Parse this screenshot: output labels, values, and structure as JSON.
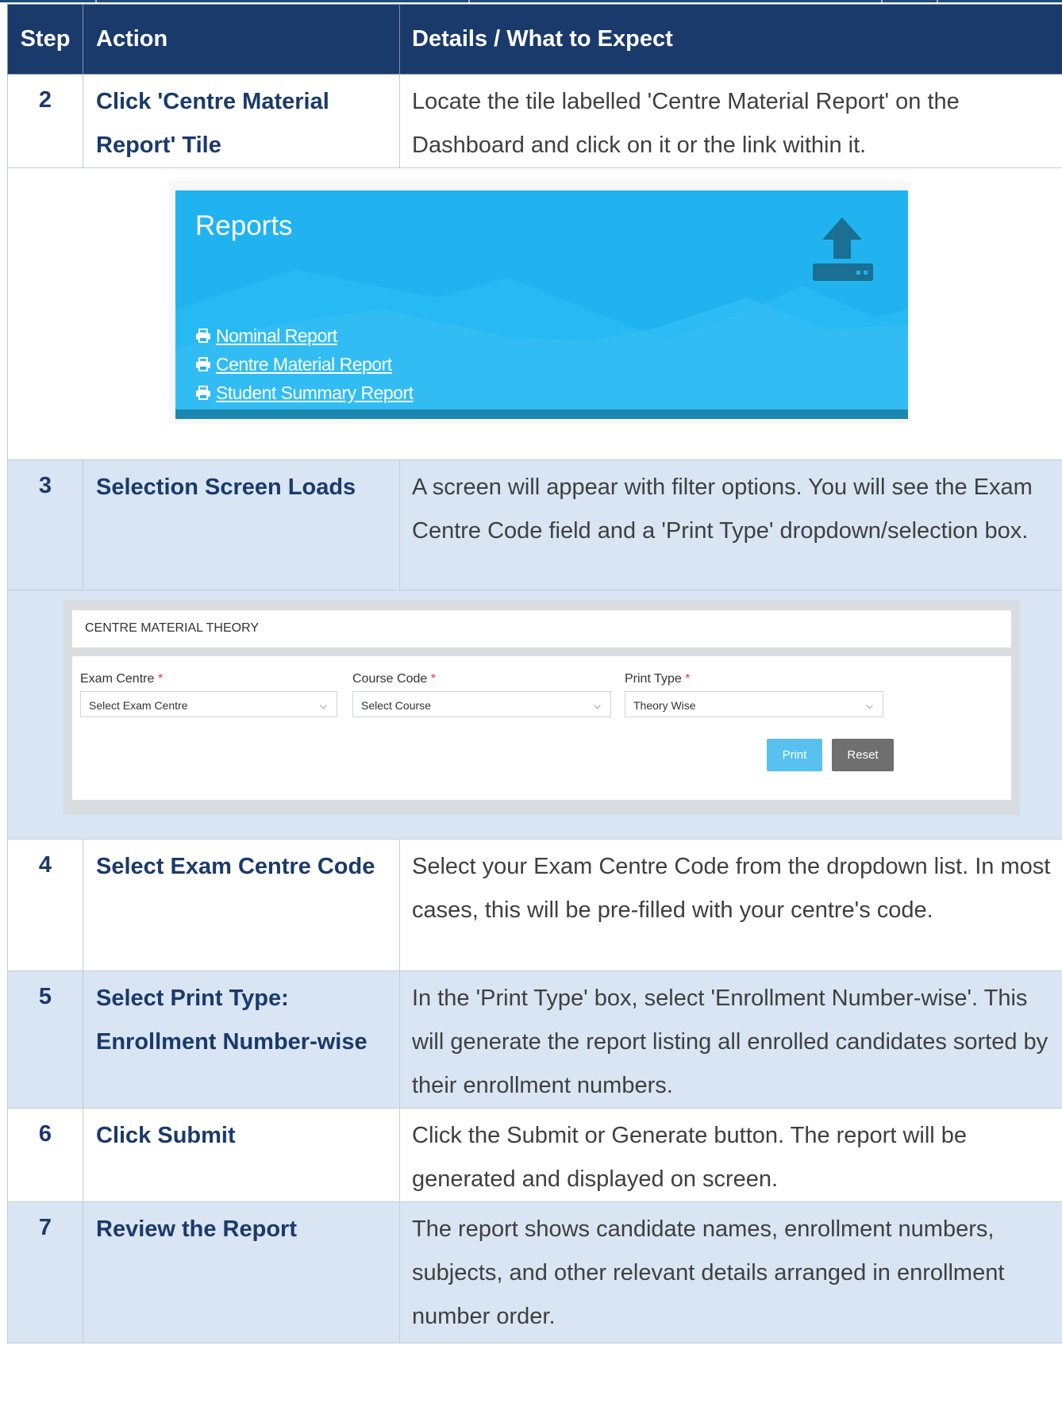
{
  "table": {
    "headers": {
      "step": "Step",
      "action": "Action",
      "details": "Details / What to Expect"
    },
    "rows": [
      {
        "num": "2",
        "action": "Click 'Centre Material Report' Tile",
        "details": "Locate the tile labelled 'Centre Material Report' on the Dashboard and click on it or the link within it."
      },
      {
        "num": "3",
        "action": "Selection Screen Loads",
        "details": "A screen will appear with filter options. You will see the Exam Centre Code field and a 'Print Type' dropdown/selection box."
      },
      {
        "num": "4",
        "action": "Select Exam Centre Code",
        "details": "Select your Exam Centre Code from the dropdown list. In most cases, this will be pre-filled with your centre's code."
      },
      {
        "num": "5",
        "action": "Select Print Type: Enrollment Number-wise",
        "details": "In the 'Print Type' box, select 'Enrollment Number-wise'. This will generate the report listing all enrolled candidates sorted by their enrollment numbers."
      },
      {
        "num": "6",
        "action": "Click Submit",
        "details": "Click the Submit or Generate button. The report will be generated and displayed on screen."
      },
      {
        "num": "7",
        "action": "Review the Report",
        "details": "The report shows candidate names, enrollment numbers, subjects, and other relevant details arranged in enrollment number order."
      }
    ]
  },
  "reports_tile": {
    "title": "Reports",
    "icon": "upload-icon",
    "links": [
      "Nominal Report",
      "Centre Material Report",
      "Student Summary Report"
    ],
    "colors": {
      "tile": "#20b3f0",
      "bar": "#1e87b0"
    }
  },
  "form": {
    "heading": "CENTRE MATERIAL THEORY",
    "fields": [
      {
        "label": "Exam Centre",
        "value": "Select Exam Centre"
      },
      {
        "label": "Course Code",
        "value": "Select Course"
      },
      {
        "label": "Print Type",
        "value": "Theory Wise"
      }
    ],
    "required_mark": "*",
    "print_label": "Print",
    "reset_label": "Reset"
  },
  "colors": {
    "header": "#1a3a6b",
    "row_blue": "#d9e5f3",
    "accent_text": "#1a3a6b"
  }
}
